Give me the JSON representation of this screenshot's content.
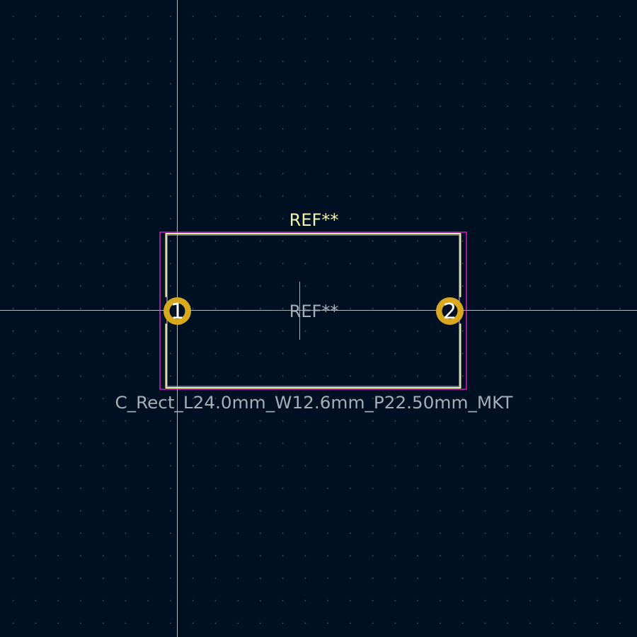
{
  "footprint": {
    "reference_silk": "REF**",
    "reference_fab": "REF**",
    "value": "C_Rect_L24.0mm_W12.6mm_P22.50mm_MKT"
  },
  "pads": [
    {
      "number": "1"
    },
    {
      "number": "2"
    }
  ],
  "colors": {
    "background": "#001023",
    "grid_dots": "#78879a",
    "crosshair": "#c8cdd2",
    "silkscreen": "#f2f2a8",
    "fab_outline": "#a6adb5",
    "courtyard": "#ff26e2",
    "pad": "#d8a81e"
  }
}
